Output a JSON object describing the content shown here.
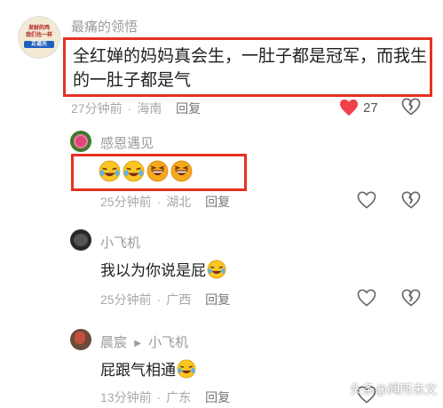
{
  "comments": [
    {
      "user": "最痛的领悟",
      "avatar_text": [
        "发财的鸡",
        "我们也一样",
        "正道光"
      ],
      "text_line1": "全红婵的妈妈真会生，一肚子都是冠军，而我生",
      "text_line2": "的一肚子都是气",
      "time": "27分钟前",
      "location": "海南",
      "reply": "回复",
      "likes": "27",
      "liked": true
    },
    {
      "user": "感恩遇见",
      "emoji_count": 4,
      "time": "25分钟前",
      "location": "湖北",
      "reply": "回复"
    },
    {
      "user": "小飞机",
      "text": "我以为你说是屁",
      "time": "25分钟前",
      "location": "广西",
      "reply": "回复"
    },
    {
      "user": "晨宸",
      "reply_arrow": "▶",
      "reply_to": "小飞机",
      "text": "屁跟气相通",
      "time": "13分钟前",
      "location": "广东",
      "reply": "回复"
    }
  ],
  "watermark": "头条@闻所未文",
  "colors": {
    "highlight_border": "#e53122",
    "like_active": "#f0404a"
  },
  "icons": [
    "heart-icon",
    "broken-heart-icon",
    "laughing-tears-emoji"
  ]
}
